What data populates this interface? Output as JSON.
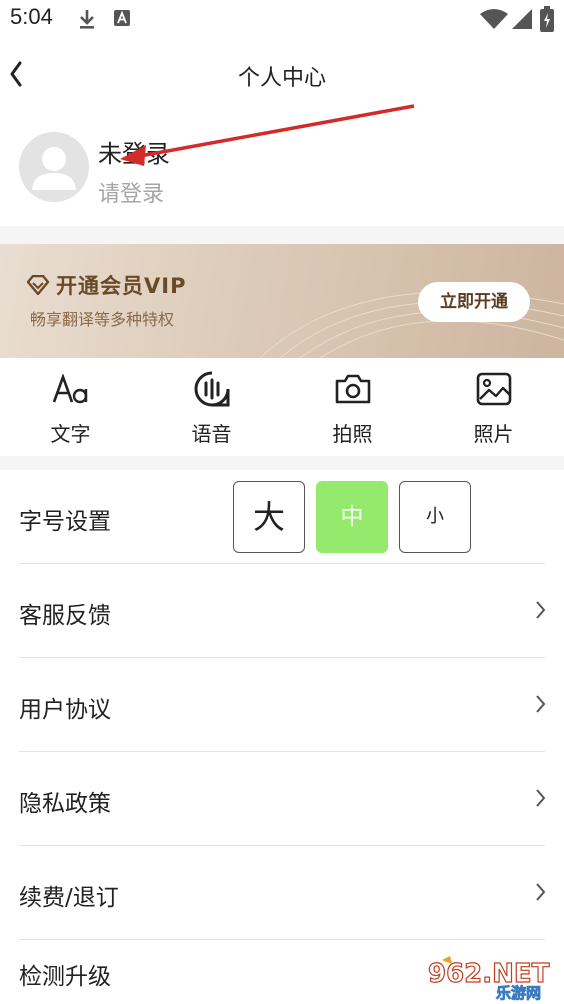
{
  "status_bar": {
    "time": "5:04",
    "icons": [
      "download-icon",
      "text-a-icon",
      "wifi-icon",
      "signal-icon",
      "battery-icon"
    ]
  },
  "header": {
    "title": "个人中心",
    "back_icon": "chevron-left-icon"
  },
  "user": {
    "name": "未登录",
    "hint": "请登录",
    "avatar_icon": "default-avatar-icon"
  },
  "vip": {
    "title": "开通会员VIP",
    "subtitle": "畅享翻译等多种特权",
    "button": "立即开通",
    "icon": "diamond-icon"
  },
  "tools": [
    {
      "label": "文字",
      "icon": "text-aa-icon"
    },
    {
      "label": "语音",
      "icon": "voice-icon"
    },
    {
      "label": "拍照",
      "icon": "camera-icon"
    },
    {
      "label": "照片",
      "icon": "photo-icon"
    }
  ],
  "font_size": {
    "label": "字号设置",
    "options": [
      "大",
      "中",
      "小"
    ],
    "selected": "中"
  },
  "menu": [
    {
      "label": "客服反馈"
    },
    {
      "label": "用户协议"
    },
    {
      "label": "隐私政策"
    },
    {
      "label": "续费/退订"
    },
    {
      "label": "检测升级"
    }
  ],
  "watermark": {
    "logo_text": "962.NET",
    "sub_text": "乐游网"
  },
  "colors": {
    "accent_green": "#95ea6e",
    "annotation_red": "#d42a2a",
    "vip_brown": "#6a4a26"
  }
}
